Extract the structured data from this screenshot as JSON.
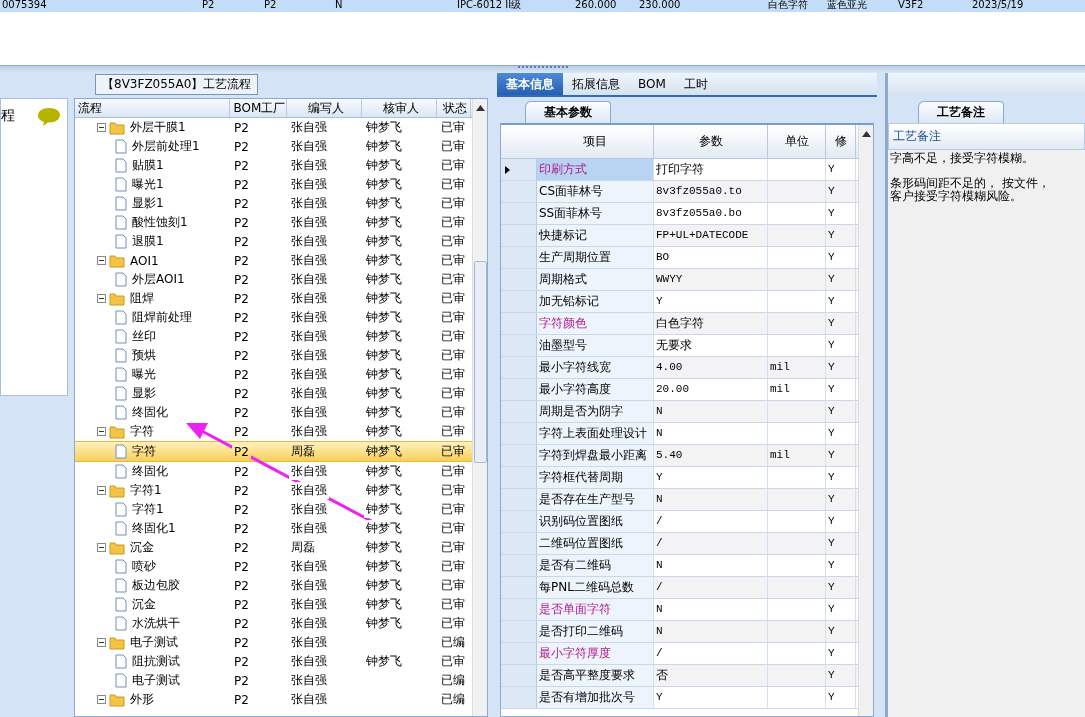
{
  "top_table": {
    "rows": [
      {
        "cells": [
          "0075394",
          "P2",
          "P2",
          "N",
          "IPC-6012 II级",
          "260.000",
          "230.000",
          "白色字符",
          "蓝色亚光",
          "V3F2",
          "2023/5/19"
        ],
        "selected": true
      }
    ]
  },
  "process_panel": {
    "title": "【8V3FZ055A0】工艺流程",
    "side_label": "程",
    "tree": {
      "columns": [
        "流程",
        "BOM工厂",
        "编写人",
        "核审人",
        "状态"
      ],
      "rows": [
        {
          "name": "外层干膜1",
          "bom": "P2",
          "writer": "张自强",
          "reviewer": "钟梦飞",
          "status": "已审",
          "selected": false,
          "expanded": true,
          "children": [
            {
              "name": "外层前处理1",
              "bom": "P2",
              "writer": "张自强",
              "reviewer": "钟梦飞",
              "status": "已审",
              "selected": false
            },
            {
              "name": "贴膜1",
              "bom": "P2",
              "writer": "张自强",
              "reviewer": "钟梦飞",
              "status": "已审",
              "selected": false
            },
            {
              "name": "曝光1",
              "bom": "P2",
              "writer": "张自强",
              "reviewer": "钟梦飞",
              "status": "已审",
              "selected": false
            },
            {
              "name": "显影1",
              "bom": "P2",
              "writer": "张自强",
              "reviewer": "钟梦飞",
              "status": "已审",
              "selected": false
            },
            {
              "name": "酸性蚀刻1",
              "bom": "P2",
              "writer": "张自强",
              "reviewer": "钟梦飞",
              "status": "已审",
              "selected": false
            },
            {
              "name": "退膜1",
              "bom": "P2",
              "writer": "张自强",
              "reviewer": "钟梦飞",
              "status": "已审",
              "selected": false
            }
          ]
        },
        {
          "name": "AOI1",
          "bom": "P2",
          "writer": "张自强",
          "reviewer": "钟梦飞",
          "status": "已审",
          "selected": false,
          "expanded": true,
          "children": [
            {
              "name": "外层AOI1",
              "bom": "P2",
              "writer": "张自强",
              "reviewer": "钟梦飞",
              "status": "已审",
              "selected": false
            }
          ]
        },
        {
          "name": "阻焊",
          "bom": "P2",
          "writer": "张自强",
          "reviewer": "钟梦飞",
          "status": "已审",
          "selected": false,
          "expanded": true,
          "children": [
            {
              "name": "阻焊前处理",
              "bom": "P2",
              "writer": "张自强",
              "reviewer": "钟梦飞",
              "status": "已审",
              "selected": false
            },
            {
              "name": "丝印",
              "bom": "P2",
              "writer": "张自强",
              "reviewer": "钟梦飞",
              "status": "已审",
              "selected": false
            },
            {
              "name": "预烘",
              "bom": "P2",
              "writer": "张自强",
              "reviewer": "钟梦飞",
              "status": "已审",
              "selected": false
            },
            {
              "name": "曝光",
              "bom": "P2",
              "writer": "张自强",
              "reviewer": "钟梦飞",
              "status": "已审",
              "selected": false
            },
            {
              "name": "显影",
              "bom": "P2",
              "writer": "张自强",
              "reviewer": "钟梦飞",
              "status": "已审",
              "selected": false
            },
            {
              "name": "终固化",
              "bom": "P2",
              "writer": "张自强",
              "reviewer": "钟梦飞",
              "status": "已审",
              "selected": false
            }
          ]
        },
        {
          "name": "字符",
          "bom": "P2",
          "writer": "张自强",
          "reviewer": "钟梦飞",
          "status": "已审",
          "selected": false,
          "expanded": true,
          "children": [
            {
              "name": "字符",
              "bom": "P2",
              "writer": "周磊",
              "reviewer": "钟梦飞",
              "status": "已审",
              "selected": true
            },
            {
              "name": "终固化",
              "bom": "P2",
              "writer": "张自强",
              "reviewer": "钟梦飞",
              "status": "已审",
              "selected": false
            }
          ]
        },
        {
          "name": "字符1",
          "bom": "P2",
          "writer": "张自强",
          "reviewer": "钟梦飞",
          "status": "已审",
          "selected": false,
          "expanded": true,
          "children": [
            {
              "name": "字符1",
              "bom": "P2",
              "writer": "张自强",
              "reviewer": "钟梦飞",
              "status": "已审",
              "selected": false
            },
            {
              "name": "终固化1",
              "bom": "P2",
              "writer": "张自强",
              "reviewer": "钟梦飞",
              "status": "已审",
              "selected": false
            }
          ]
        },
        {
          "name": "沉金",
          "bom": "P2",
          "writer": "周磊",
          "reviewer": "钟梦飞",
          "status": "已审",
          "selected": false,
          "expanded": true,
          "children": [
            {
              "name": "喷砂",
              "bom": "P2",
              "writer": "张自强",
              "reviewer": "钟梦飞",
              "status": "已审",
              "selected": false
            },
            {
              "name": "板边包胶",
              "bom": "P2",
              "writer": "张自强",
              "reviewer": "钟梦飞",
              "status": "已审",
              "selected": false
            },
            {
              "name": "沉金",
              "bom": "P2",
              "writer": "张自强",
              "reviewer": "钟梦飞",
              "status": "已审",
              "selected": false
            },
            {
              "name": "水洗烘干",
              "bom": "P2",
              "writer": "张自强",
              "reviewer": "钟梦飞",
              "status": "已审",
              "selected": false
            }
          ]
        },
        {
          "name": "电子测试",
          "bom": "P2",
          "writer": "张自强",
          "status": "已编",
          "selected": false,
          "expanded": true,
          "children": [
            {
              "name": "阻抗测试",
              "bom": "P2",
              "writer": "张自强",
              "reviewer": "钟梦飞",
              "status": "已审",
              "selected": false
            },
            {
              "name": "电子测试",
              "bom": "P2",
              "writer": "张自强",
              "status": "已编",
              "selected": false
            }
          ]
        },
        {
          "name": "外形",
          "bom": "P2",
          "writer": "张自强",
          "status": "已编",
          "selected": false,
          "expanded": true
        }
      ]
    }
  },
  "detail_panel": {
    "tabs": [
      {
        "label": "基本信息",
        "selected": true
      },
      {
        "label": "拓展信息",
        "selected": false
      },
      {
        "label": "BOM",
        "selected": false
      },
      {
        "label": "工时",
        "selected": false
      }
    ],
    "subtab": "基本参数",
    "grid": {
      "columns": [
        "项目",
        "参数",
        "单位",
        "修"
      ],
      "rows": [
        {
          "item": "印刷方式",
          "value": "打印字符",
          "modified": "Y",
          "flagged": true,
          "selected": true
        },
        {
          "item": "CS面菲林号",
          "value": "8v3fz055a0.to",
          "modified": "Y",
          "flagged": false,
          "selected": false
        },
        {
          "item": "SS面菲林号",
          "value": "8v3fz055a0.bo",
          "modified": "Y",
          "flagged": false,
          "selected": false
        },
        {
          "item": "快捷标记",
          "value": "FP+UL+DATECODE",
          "modified": "Y",
          "flagged": false,
          "selected": false
        },
        {
          "item": "生产周期位置",
          "value": "BO",
          "modified": "Y",
          "flagged": false,
          "selected": false
        },
        {
          "item": "周期格式",
          "value": "WWYY",
          "modified": "Y",
          "flagged": false,
          "selected": false
        },
        {
          "item": "加无铅标记",
          "value": "Y",
          "modified": "Y",
          "flagged": false,
          "selected": false
        },
        {
          "item": "字符颜色",
          "value": "白色字符",
          "modified": "Y",
          "flagged": true,
          "selected": false
        },
        {
          "item": "油墨型号",
          "value": "无要求",
          "modified": "Y",
          "flagged": false,
          "selected": false
        },
        {
          "item": "最小字符线宽",
          "value": "4.00",
          "unit": "mil",
          "modified": "Y",
          "flagged": false,
          "selected": false
        },
        {
          "item": "最小字符高度",
          "value": "20.00",
          "unit": "mil",
          "modified": "Y",
          "flagged": false,
          "selected": false
        },
        {
          "item": "周期是否为阴字",
          "value": "N",
          "modified": "Y",
          "flagged": false,
          "selected": false
        },
        {
          "item": "字符上表面处理设计",
          "value": "N",
          "modified": "Y",
          "flagged": false,
          "selected": false
        },
        {
          "item": "字符到焊盘最小距离",
          "value": "5.40",
          "unit": "mil",
          "modified": "Y",
          "flagged": false,
          "selected": false
        },
        {
          "item": "字符框代替周期",
          "value": "Y",
          "modified": "Y",
          "flagged": false,
          "selected": false
        },
        {
          "item": "是否存在生产型号",
          "value": "N",
          "modified": "Y",
          "flagged": false,
          "selected": false
        },
        {
          "item": "识别码位置图纸",
          "value": "/",
          "modified": "Y",
          "flagged": false,
          "selected": false
        },
        {
          "item": "二维码位置图纸",
          "value": "/",
          "modified": "Y",
          "flagged": false,
          "selected": false
        },
        {
          "item": "是否有二维码",
          "value": "N",
          "modified": "Y",
          "flagged": false,
          "selected": false
        },
        {
          "item": "每PNL二维码总数",
          "value": "/",
          "modified": "Y",
          "flagged": false,
          "selected": false
        },
        {
          "item": "是否单面字符",
          "value": "N",
          "modified": "Y",
          "flagged": true,
          "selected": false
        },
        {
          "item": "是否打印二维码",
          "value": "N",
          "modified": "Y",
          "flagged": false,
          "selected": false
        },
        {
          "item": "最小字符厚度",
          "value": "/",
          "modified": "Y",
          "flagged": true,
          "selected": false
        },
        {
          "item": "是否高平整度要求",
          "value": "否",
          "modified": "Y",
          "flagged": false,
          "selected": false
        },
        {
          "item": "是否有增加批次号",
          "value": "Y",
          "modified": "Y",
          "flagged": false,
          "selected": false
        }
      ]
    }
  },
  "notes_panel": {
    "tab": "工艺备注",
    "column": "工艺备注",
    "paragraphs": [
      [
        "字高不足，接受字符模糊。"
      ],
      [
        "条形码间距不足的， 按文件，",
        "客户接受字符模糊风险。"
      ]
    ]
  }
}
